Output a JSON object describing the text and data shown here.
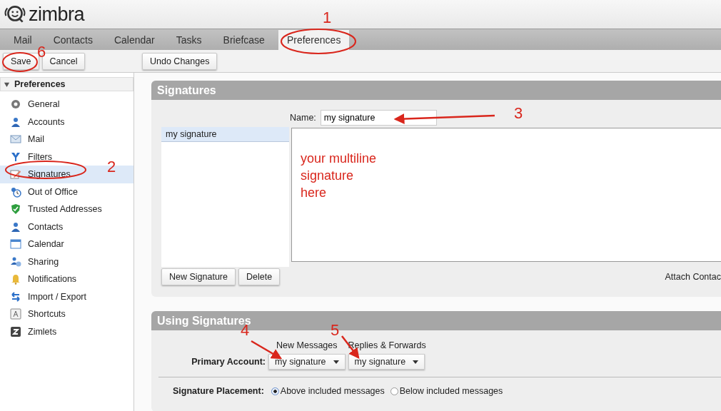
{
  "app": {
    "logo": "zimbra"
  },
  "tabs": [
    {
      "label": "Mail",
      "selected": false
    },
    {
      "label": "Contacts",
      "selected": false
    },
    {
      "label": "Calendar",
      "selected": false
    },
    {
      "label": "Tasks",
      "selected": false
    },
    {
      "label": "Briefcase",
      "selected": false
    },
    {
      "label": "Preferences",
      "selected": true
    }
  ],
  "toolbar": {
    "left_buttons": [
      "Save",
      "Cancel"
    ],
    "right_buttons": [
      "Undo Changes"
    ]
  },
  "sidebar": {
    "title": "Preferences",
    "expanded": true,
    "items": [
      {
        "label": "General",
        "selected": false
      },
      {
        "label": "Accounts",
        "selected": false
      },
      {
        "label": "Mail",
        "selected": false
      },
      {
        "label": "Filters",
        "selected": false
      },
      {
        "label": "Signatures",
        "selected": true
      },
      {
        "label": "Out of Office",
        "selected": false
      },
      {
        "label": "Trusted Addresses",
        "selected": false
      },
      {
        "label": "Contacts",
        "selected": false
      },
      {
        "label": "Calendar",
        "selected": false
      },
      {
        "label": "Sharing",
        "selected": false
      },
      {
        "label": "Notifications",
        "selected": false
      },
      {
        "label": "Import / Export",
        "selected": false
      },
      {
        "label": "Shortcuts",
        "selected": false
      },
      {
        "label": "Zimlets",
        "selected": false
      }
    ]
  },
  "signatures": {
    "title": "Signatures",
    "name_label": "Name:",
    "name_value": "my signature",
    "list": [
      {
        "label": "my signature",
        "selected": true
      }
    ],
    "body_lines": [
      "your multiline",
      "signature",
      "here"
    ],
    "buttons": [
      "New Signature",
      "Delete"
    ],
    "attach_label": "Attach Contac"
  },
  "using": {
    "title": "Using Signatures",
    "columns": [
      "New Messages",
      "Replies & Forwards"
    ],
    "account_label": "Primary Account:",
    "selects": [
      "my signature",
      "my signature"
    ],
    "placement_label": "Signature Placement:",
    "placement_options": [
      {
        "label": "Above included messages",
        "selected": true
      },
      {
        "label": "Below included messages",
        "selected": false
      }
    ]
  },
  "annotations": [
    "1",
    "2",
    "3",
    "4",
    "5",
    "6"
  ]
}
